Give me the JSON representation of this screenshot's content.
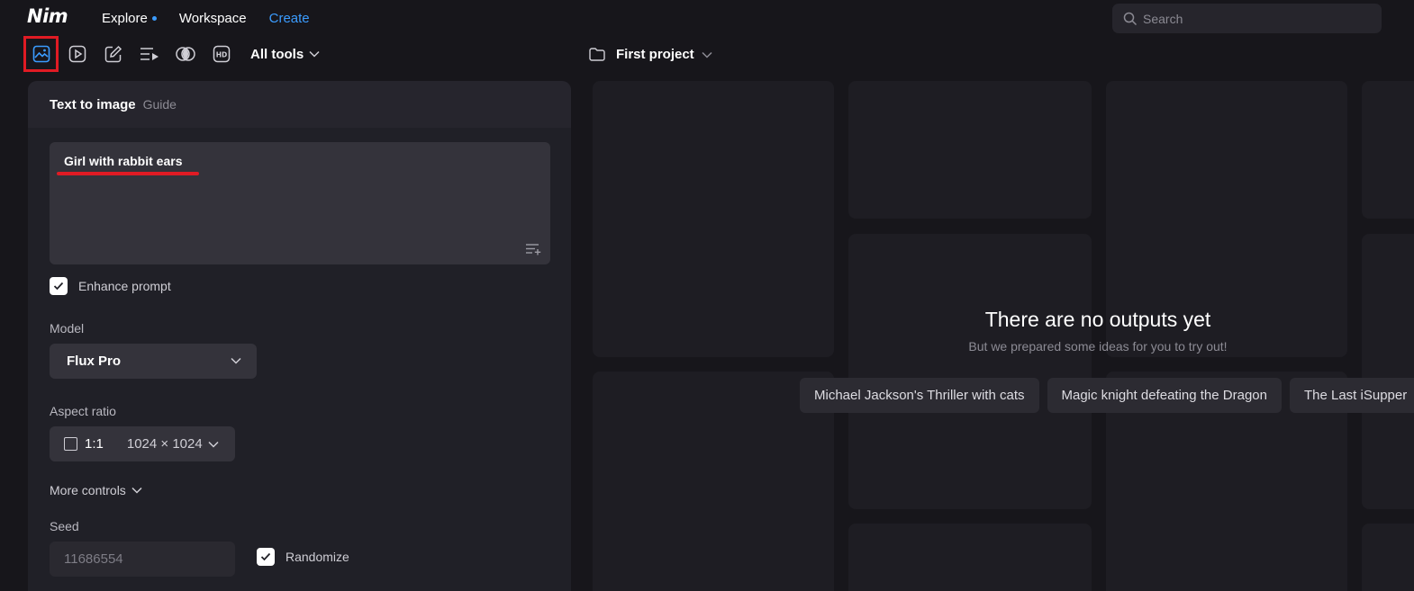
{
  "app": {
    "logo": "Nim"
  },
  "nav": {
    "explore": "Explore",
    "workspace": "Workspace",
    "create": "Create"
  },
  "search": {
    "placeholder": "Search"
  },
  "tools": {
    "items": [
      "image-icon",
      "video-icon",
      "edit-icon",
      "playlist-icon",
      "blend-icon",
      "hd-icon"
    ],
    "all_tools_label": "All tools"
  },
  "project": {
    "name": "First project"
  },
  "panel": {
    "title": "Text to image",
    "guide": "Guide",
    "prompt": "Girl with rabbit ears",
    "enhance_label": "Enhance prompt",
    "enhance_checked": true,
    "model_label": "Model",
    "model_value": "Flux Pro",
    "aspect_label": "Aspect ratio",
    "aspect_ratio": "1:1",
    "aspect_size": "1024 × 1024",
    "more_controls": "More controls",
    "seed_label": "Seed",
    "seed_value": "11686554",
    "randomize_label": "Randomize",
    "randomize_checked": true
  },
  "empty_state": {
    "title": "There are no outputs yet",
    "subtitle": "But we prepared some ideas for you to try out!",
    "ideas": [
      "Michael Jackson's Thriller with cats",
      "Magic knight defeating the Dragon",
      "The Last iSupper"
    ]
  },
  "colors": {
    "accent": "#3b9cff",
    "highlight": "#e01b24",
    "background": "#17161b",
    "panel": "#202027"
  }
}
